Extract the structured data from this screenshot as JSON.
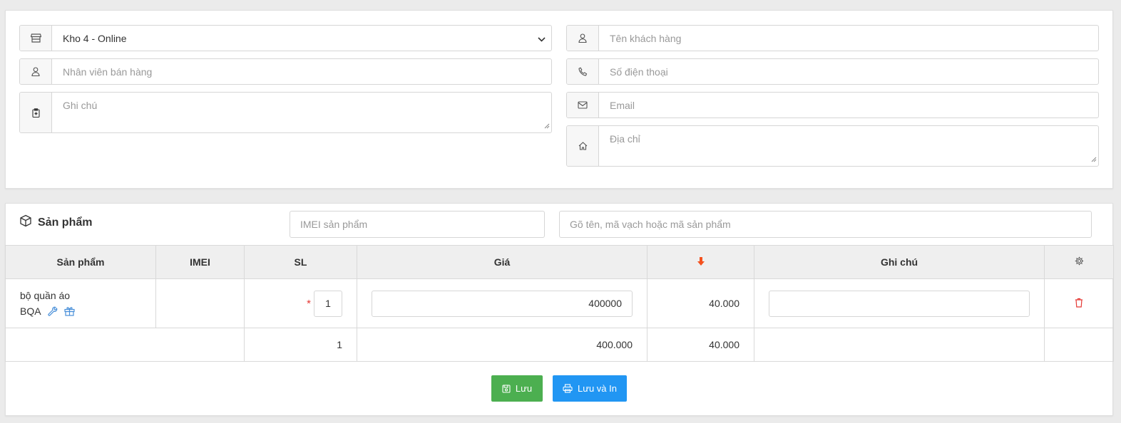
{
  "order_form": {
    "warehouse": {
      "value": "Kho 4 - Online",
      "icon": "store-icon"
    },
    "salesperson": {
      "placeholder": "Nhân viên bán hàng",
      "icon": "user-icon"
    },
    "note": {
      "placeholder": "Ghi chú",
      "icon": "clipboard-icon"
    }
  },
  "customer": {
    "name": {
      "placeholder": "Tên khách hàng",
      "icon": "user-icon"
    },
    "phone": {
      "placeholder": "Số điện thoại",
      "icon": "phone-icon"
    },
    "email": {
      "placeholder": "Email",
      "icon": "envelope-icon"
    },
    "address": {
      "placeholder": "Địa chỉ",
      "icon": "home-icon"
    }
  },
  "products": {
    "title": "Sản phẩm",
    "imei_search_placeholder": "IMEI sản phẩm",
    "product_search_placeholder": "Gõ tên, mã vạch hoặc mã sản phẩm",
    "columns": [
      "Sản phẩm",
      "IMEI",
      "SL",
      "Giá",
      "",
      "Ghi chú",
      ""
    ],
    "rows": [
      {
        "name": "bộ quần áo",
        "code": "BQA",
        "imei": "",
        "quantity": "1",
        "required_mark": "*",
        "price": "400000",
        "discount": "40.000",
        "note": ""
      }
    ],
    "totals": {
      "quantity": "1",
      "price": "400.000",
      "discount": "40.000"
    }
  },
  "actions": {
    "save_label": "Lưu",
    "save_print_label": "Lưu và In"
  },
  "colors": {
    "save_button": "#4caf50",
    "save_print_button": "#2196f3",
    "discount_arrow": "#f4511e",
    "delete_icon": "#e53935",
    "tool_icons": "#4a90d9"
  }
}
